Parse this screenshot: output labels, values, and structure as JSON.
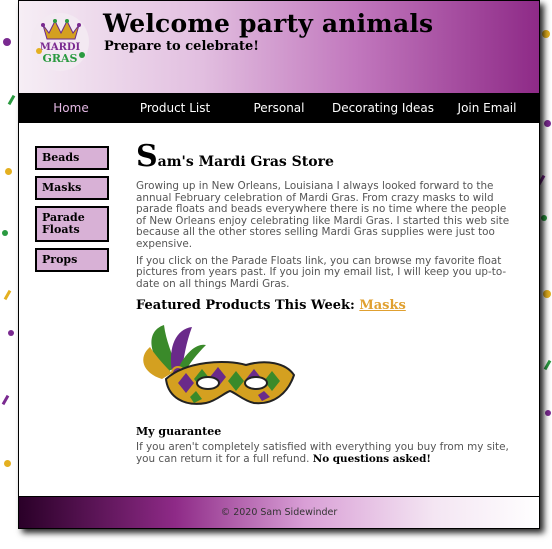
{
  "header": {
    "title": "Welcome party animals",
    "subtitle": "Prepare to celebrate!",
    "logo_text": "Mardi Gras"
  },
  "nav": {
    "items": [
      {
        "label": "Home",
        "active": true
      },
      {
        "label": "Product List",
        "active": false
      },
      {
        "label": "Personal",
        "active": false
      },
      {
        "label": "Decorating Ideas",
        "active": false
      },
      {
        "label": "Join Email",
        "active": false
      }
    ]
  },
  "sidebar": {
    "items": [
      {
        "label": "Beads"
      },
      {
        "label": "Masks"
      },
      {
        "label": "Parade Floats"
      },
      {
        "label": "Props"
      }
    ]
  },
  "main": {
    "title_initial": "S",
    "title_rest": "am's Mardi Gras Store",
    "paragraph1": "Growing up in New Orleans, Louisiana I always looked forward to the annual February celebration of Mardi Gras. From crazy masks to wild parade floats and beads everywhere there is no time where the people of New Orleans enjoy celebrating like Mardi Gras. I started this web site because all the other stores selling Mardi Gras supplies were just too expensive.",
    "paragraph2": "If you click on the Parade Floats link, you can browse my favorite float pictures from years past. If you join my email list, I will keep you up-to-date on all things Mardi Gras.",
    "featured_label": "Featured Products This Week: ",
    "featured_link": "Masks",
    "guarantee_heading": "My guarantee",
    "guarantee_text": "If you aren't completely satisfied with everything you buy from my site, you can return it for a full refund. ",
    "guarantee_strong": "No questions asked!"
  },
  "footer": {
    "text": "© 2020 Sam Sidewinder"
  },
  "colors": {
    "header_purple": "#8e2a87",
    "sidebar_button": "#d8b1d6",
    "link_gold": "#e0a030",
    "mask_green": "#3a8a2a",
    "mask_gold": "#d4a020",
    "mask_purple": "#6a2a8a"
  }
}
